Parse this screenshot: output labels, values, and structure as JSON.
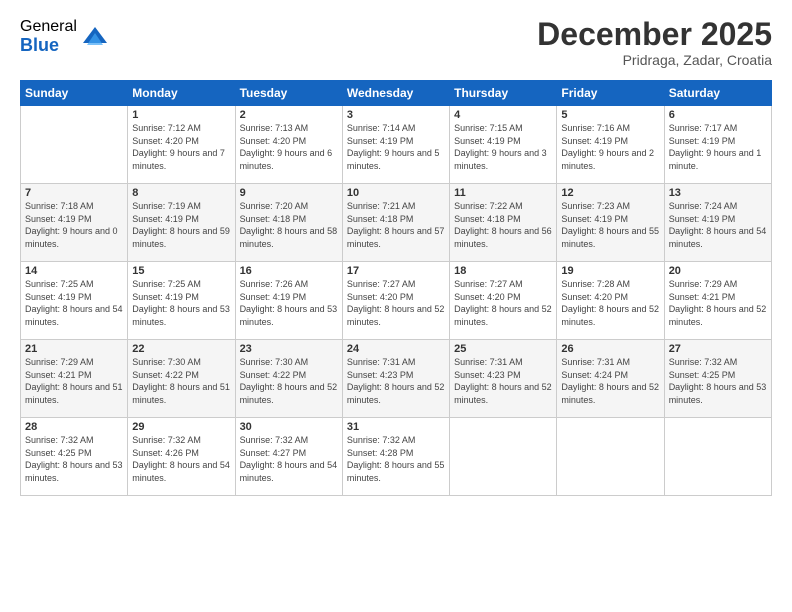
{
  "logo": {
    "general": "General",
    "blue": "Blue"
  },
  "header": {
    "month": "December 2025",
    "location": "Pridraga, Zadar, Croatia"
  },
  "weekdays": [
    "Sunday",
    "Monday",
    "Tuesday",
    "Wednesday",
    "Thursday",
    "Friday",
    "Saturday"
  ],
  "weeks": [
    [
      {
        "day": "",
        "sunrise": "",
        "sunset": "",
        "daylight": ""
      },
      {
        "day": "1",
        "sunrise": "Sunrise: 7:12 AM",
        "sunset": "Sunset: 4:20 PM",
        "daylight": "Daylight: 9 hours and 7 minutes."
      },
      {
        "day": "2",
        "sunrise": "Sunrise: 7:13 AM",
        "sunset": "Sunset: 4:20 PM",
        "daylight": "Daylight: 9 hours and 6 minutes."
      },
      {
        "day": "3",
        "sunrise": "Sunrise: 7:14 AM",
        "sunset": "Sunset: 4:19 PM",
        "daylight": "Daylight: 9 hours and 5 minutes."
      },
      {
        "day": "4",
        "sunrise": "Sunrise: 7:15 AM",
        "sunset": "Sunset: 4:19 PM",
        "daylight": "Daylight: 9 hours and 3 minutes."
      },
      {
        "day": "5",
        "sunrise": "Sunrise: 7:16 AM",
        "sunset": "Sunset: 4:19 PM",
        "daylight": "Daylight: 9 hours and 2 minutes."
      },
      {
        "day": "6",
        "sunrise": "Sunrise: 7:17 AM",
        "sunset": "Sunset: 4:19 PM",
        "daylight": "Daylight: 9 hours and 1 minute."
      }
    ],
    [
      {
        "day": "7",
        "sunrise": "Sunrise: 7:18 AM",
        "sunset": "Sunset: 4:19 PM",
        "daylight": "Daylight: 9 hours and 0 minutes."
      },
      {
        "day": "8",
        "sunrise": "Sunrise: 7:19 AM",
        "sunset": "Sunset: 4:19 PM",
        "daylight": "Daylight: 8 hours and 59 minutes."
      },
      {
        "day": "9",
        "sunrise": "Sunrise: 7:20 AM",
        "sunset": "Sunset: 4:18 PM",
        "daylight": "Daylight: 8 hours and 58 minutes."
      },
      {
        "day": "10",
        "sunrise": "Sunrise: 7:21 AM",
        "sunset": "Sunset: 4:18 PM",
        "daylight": "Daylight: 8 hours and 57 minutes."
      },
      {
        "day": "11",
        "sunrise": "Sunrise: 7:22 AM",
        "sunset": "Sunset: 4:18 PM",
        "daylight": "Daylight: 8 hours and 56 minutes."
      },
      {
        "day": "12",
        "sunrise": "Sunrise: 7:23 AM",
        "sunset": "Sunset: 4:19 PM",
        "daylight": "Daylight: 8 hours and 55 minutes."
      },
      {
        "day": "13",
        "sunrise": "Sunrise: 7:24 AM",
        "sunset": "Sunset: 4:19 PM",
        "daylight": "Daylight: 8 hours and 54 minutes."
      }
    ],
    [
      {
        "day": "14",
        "sunrise": "Sunrise: 7:25 AM",
        "sunset": "Sunset: 4:19 PM",
        "daylight": "Daylight: 8 hours and 54 minutes."
      },
      {
        "day": "15",
        "sunrise": "Sunrise: 7:25 AM",
        "sunset": "Sunset: 4:19 PM",
        "daylight": "Daylight: 8 hours and 53 minutes."
      },
      {
        "day": "16",
        "sunrise": "Sunrise: 7:26 AM",
        "sunset": "Sunset: 4:19 PM",
        "daylight": "Daylight: 8 hours and 53 minutes."
      },
      {
        "day": "17",
        "sunrise": "Sunrise: 7:27 AM",
        "sunset": "Sunset: 4:20 PM",
        "daylight": "Daylight: 8 hours and 52 minutes."
      },
      {
        "day": "18",
        "sunrise": "Sunrise: 7:27 AM",
        "sunset": "Sunset: 4:20 PM",
        "daylight": "Daylight: 8 hours and 52 minutes."
      },
      {
        "day": "19",
        "sunrise": "Sunrise: 7:28 AM",
        "sunset": "Sunset: 4:20 PM",
        "daylight": "Daylight: 8 hours and 52 minutes."
      },
      {
        "day": "20",
        "sunrise": "Sunrise: 7:29 AM",
        "sunset": "Sunset: 4:21 PM",
        "daylight": "Daylight: 8 hours and 52 minutes."
      }
    ],
    [
      {
        "day": "21",
        "sunrise": "Sunrise: 7:29 AM",
        "sunset": "Sunset: 4:21 PM",
        "daylight": "Daylight: 8 hours and 51 minutes."
      },
      {
        "day": "22",
        "sunrise": "Sunrise: 7:30 AM",
        "sunset": "Sunset: 4:22 PM",
        "daylight": "Daylight: 8 hours and 51 minutes."
      },
      {
        "day": "23",
        "sunrise": "Sunrise: 7:30 AM",
        "sunset": "Sunset: 4:22 PM",
        "daylight": "Daylight: 8 hours and 52 minutes."
      },
      {
        "day": "24",
        "sunrise": "Sunrise: 7:31 AM",
        "sunset": "Sunset: 4:23 PM",
        "daylight": "Daylight: 8 hours and 52 minutes."
      },
      {
        "day": "25",
        "sunrise": "Sunrise: 7:31 AM",
        "sunset": "Sunset: 4:23 PM",
        "daylight": "Daylight: 8 hours and 52 minutes."
      },
      {
        "day": "26",
        "sunrise": "Sunrise: 7:31 AM",
        "sunset": "Sunset: 4:24 PM",
        "daylight": "Daylight: 8 hours and 52 minutes."
      },
      {
        "day": "27",
        "sunrise": "Sunrise: 7:32 AM",
        "sunset": "Sunset: 4:25 PM",
        "daylight": "Daylight: 8 hours and 53 minutes."
      }
    ],
    [
      {
        "day": "28",
        "sunrise": "Sunrise: 7:32 AM",
        "sunset": "Sunset: 4:25 PM",
        "daylight": "Daylight: 8 hours and 53 minutes."
      },
      {
        "day": "29",
        "sunrise": "Sunrise: 7:32 AM",
        "sunset": "Sunset: 4:26 PM",
        "daylight": "Daylight: 8 hours and 54 minutes."
      },
      {
        "day": "30",
        "sunrise": "Sunrise: 7:32 AM",
        "sunset": "Sunset: 4:27 PM",
        "daylight": "Daylight: 8 hours and 54 minutes."
      },
      {
        "day": "31",
        "sunrise": "Sunrise: 7:32 AM",
        "sunset": "Sunset: 4:28 PM",
        "daylight": "Daylight: 8 hours and 55 minutes."
      },
      {
        "day": "",
        "sunrise": "",
        "sunset": "",
        "daylight": ""
      },
      {
        "day": "",
        "sunrise": "",
        "sunset": "",
        "daylight": ""
      },
      {
        "day": "",
        "sunrise": "",
        "sunset": "",
        "daylight": ""
      }
    ]
  ]
}
